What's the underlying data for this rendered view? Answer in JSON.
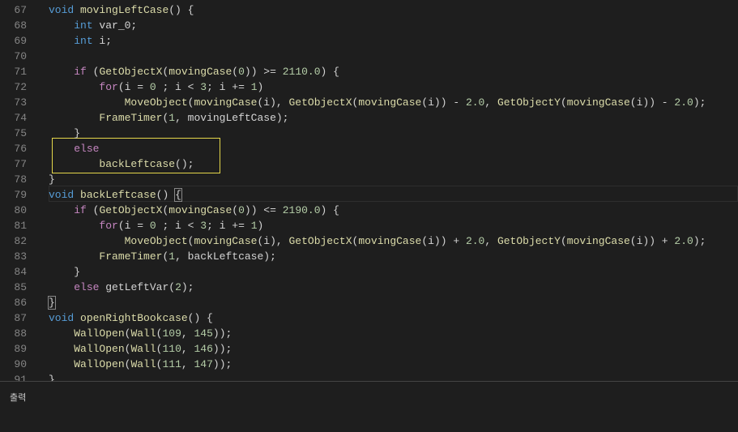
{
  "editor": {
    "first_line_number": 67,
    "current_line": 79,
    "highlighted_lines": [
      76,
      77
    ],
    "highlight_color": "#e5d74a",
    "colors": {
      "background": "#1e1e1e",
      "keyword": "#569cd6",
      "control": "#c586c0",
      "function": "#dcdcaa",
      "number": "#b5cea8",
      "text": "#d4d4d4",
      "line_number": "#858585"
    },
    "lines": [
      [
        [
          "k",
          "void"
        ],
        [
          "t",
          " "
        ],
        [
          "f",
          "movingLeftCase"
        ],
        [
          "t",
          "() {"
        ]
      ],
      [
        [
          "t",
          "    "
        ],
        [
          "k",
          "int"
        ],
        [
          "t",
          " var_0;"
        ]
      ],
      [
        [
          "t",
          "    "
        ],
        [
          "k",
          "int"
        ],
        [
          "t",
          " i;"
        ]
      ],
      [],
      [
        [
          "t",
          "    "
        ],
        [
          "c",
          "if"
        ],
        [
          "t",
          " ("
        ],
        [
          "f",
          "GetObjectX"
        ],
        [
          "t",
          "("
        ],
        [
          "f",
          "movingCase"
        ],
        [
          "t",
          "("
        ],
        [
          "n",
          "0"
        ],
        [
          "t",
          ")) >= "
        ],
        [
          "n",
          "2110.0"
        ],
        [
          "t",
          ") {"
        ]
      ],
      [
        [
          "t",
          "        "
        ],
        [
          "c",
          "for"
        ],
        [
          "t",
          "(i = "
        ],
        [
          "n",
          "0"
        ],
        [
          "t",
          " ; i < "
        ],
        [
          "n",
          "3"
        ],
        [
          "t",
          "; i += "
        ],
        [
          "n",
          "1"
        ],
        [
          "t",
          ")"
        ]
      ],
      [
        [
          "t",
          "            "
        ],
        [
          "f",
          "MoveObject"
        ],
        [
          "t",
          "("
        ],
        [
          "f",
          "movingCase"
        ],
        [
          "t",
          "(i), "
        ],
        [
          "f",
          "GetObjectX"
        ],
        [
          "t",
          "("
        ],
        [
          "f",
          "movingCase"
        ],
        [
          "t",
          "(i)) - "
        ],
        [
          "n",
          "2.0"
        ],
        [
          "t",
          ", "
        ],
        [
          "f",
          "GetObjectY"
        ],
        [
          "t",
          "("
        ],
        [
          "f",
          "movingCase"
        ],
        [
          "t",
          "(i)) - "
        ],
        [
          "n",
          "2.0"
        ],
        [
          "t",
          ");"
        ]
      ],
      [
        [
          "t",
          "        "
        ],
        [
          "f",
          "FrameTimer"
        ],
        [
          "t",
          "("
        ],
        [
          "n",
          "1"
        ],
        [
          "t",
          ", movingLeftCase);"
        ]
      ],
      [
        [
          "t",
          "    }"
        ]
      ],
      [
        [
          "t",
          "    "
        ],
        [
          "c",
          "else"
        ]
      ],
      [
        [
          "t",
          "        "
        ],
        [
          "f",
          "backLeftcase"
        ],
        [
          "t",
          "();"
        ]
      ],
      [
        [
          "t",
          "}"
        ]
      ],
      [
        [
          "k",
          "void"
        ],
        [
          "t",
          " "
        ],
        [
          "f",
          "backLeftcase"
        ],
        [
          "t",
          "() "
        ],
        [
          "bm",
          "{"
        ]
      ],
      [
        [
          "t",
          "    "
        ],
        [
          "c",
          "if"
        ],
        [
          "t",
          " ("
        ],
        [
          "f",
          "GetObjectX"
        ],
        [
          "t",
          "("
        ],
        [
          "f",
          "movingCase"
        ],
        [
          "t",
          "("
        ],
        [
          "n",
          "0"
        ],
        [
          "t",
          ")) <= "
        ],
        [
          "n",
          "2190.0"
        ],
        [
          "t",
          ") {"
        ]
      ],
      [
        [
          "t",
          "        "
        ],
        [
          "c",
          "for"
        ],
        [
          "t",
          "(i = "
        ],
        [
          "n",
          "0"
        ],
        [
          "t",
          " ; i < "
        ],
        [
          "n",
          "3"
        ],
        [
          "t",
          "; i += "
        ],
        [
          "n",
          "1"
        ],
        [
          "t",
          ")"
        ]
      ],
      [
        [
          "t",
          "            "
        ],
        [
          "f",
          "MoveObject"
        ],
        [
          "t",
          "("
        ],
        [
          "f",
          "movingCase"
        ],
        [
          "t",
          "(i), "
        ],
        [
          "f",
          "GetObjectX"
        ],
        [
          "t",
          "("
        ],
        [
          "f",
          "movingCase"
        ],
        [
          "t",
          "(i)) + "
        ],
        [
          "n",
          "2.0"
        ],
        [
          "t",
          ", "
        ],
        [
          "f",
          "GetObjectY"
        ],
        [
          "t",
          "("
        ],
        [
          "f",
          "movingCase"
        ],
        [
          "t",
          "(i)) + "
        ],
        [
          "n",
          "2.0"
        ],
        [
          "t",
          ");"
        ]
      ],
      [
        [
          "t",
          "        "
        ],
        [
          "f",
          "FrameTimer"
        ],
        [
          "t",
          "("
        ],
        [
          "n",
          "1"
        ],
        [
          "t",
          ", backLeftcase);"
        ]
      ],
      [
        [
          "t",
          "    }"
        ]
      ],
      [
        [
          "t",
          "    "
        ],
        [
          "c",
          "else"
        ],
        [
          "t",
          " getLeftVar("
        ],
        [
          "n",
          "2"
        ],
        [
          "t",
          ");"
        ]
      ],
      [
        [
          "bm",
          "}"
        ]
      ],
      [
        [
          "k",
          "void"
        ],
        [
          "t",
          " "
        ],
        [
          "f",
          "openRightBookcase"
        ],
        [
          "t",
          "() {"
        ]
      ],
      [
        [
          "t",
          "    "
        ],
        [
          "f",
          "WallOpen"
        ],
        [
          "t",
          "("
        ],
        [
          "f",
          "Wall"
        ],
        [
          "t",
          "("
        ],
        [
          "n",
          "109"
        ],
        [
          "t",
          ", "
        ],
        [
          "n",
          "145"
        ],
        [
          "t",
          "));"
        ]
      ],
      [
        [
          "t",
          "    "
        ],
        [
          "f",
          "WallOpen"
        ],
        [
          "t",
          "("
        ],
        [
          "f",
          "Wall"
        ],
        [
          "t",
          "("
        ],
        [
          "n",
          "110"
        ],
        [
          "t",
          ", "
        ],
        [
          "n",
          "146"
        ],
        [
          "t",
          "));"
        ]
      ],
      [
        [
          "t",
          "    "
        ],
        [
          "f",
          "WallOpen"
        ],
        [
          "t",
          "("
        ],
        [
          "f",
          "Wall"
        ],
        [
          "t",
          "("
        ],
        [
          "n",
          "111"
        ],
        [
          "t",
          ", "
        ],
        [
          "n",
          "147"
        ],
        [
          "t",
          "));"
        ]
      ],
      [
        [
          "t",
          "}"
        ]
      ]
    ]
  },
  "panel": {
    "title": "출력"
  }
}
